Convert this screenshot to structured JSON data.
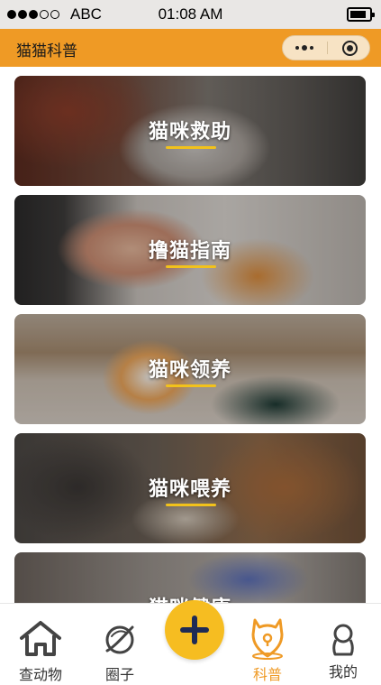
{
  "status_bar": {
    "carrier": "ABC",
    "time": "01:08 AM",
    "signal_icon": "signal-dots-icon",
    "battery_icon": "battery-icon"
  },
  "nav": {
    "title": "猫猫科普",
    "more_icon": "more-dots-icon",
    "close_icon": "capsule-close-icon",
    "color": "#ef9a25"
  },
  "cards": [
    {
      "label": "猫咪救助"
    },
    {
      "label": "撸猫指南"
    },
    {
      "label": "猫咪领养"
    },
    {
      "label": "猫咪喂养"
    },
    {
      "label": "猫咪健康"
    }
  ],
  "tabbar": {
    "items": [
      {
        "label": "查动物",
        "icon": "home-icon"
      },
      {
        "label": "圈子",
        "icon": "planet-icon"
      },
      {
        "label": "",
        "icon": "plus-icon"
      },
      {
        "label": "科普",
        "icon": "cat-pin-icon",
        "active": true
      },
      {
        "label": "我的",
        "icon": "person-icon"
      }
    ],
    "active_color": "#ef9a25",
    "fab_color": "#f6bd21"
  }
}
